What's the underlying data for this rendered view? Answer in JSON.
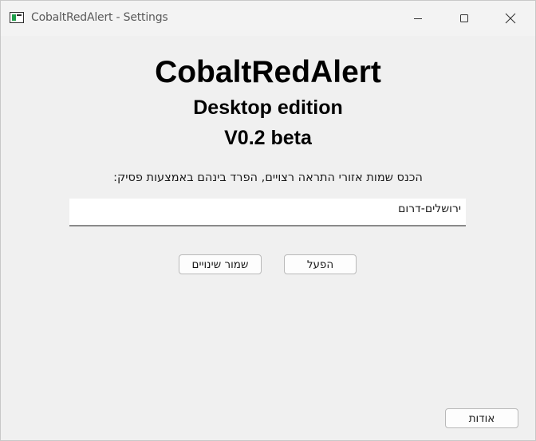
{
  "window": {
    "title": "CobaltRedAlert - Settings",
    "controls": {
      "minimize_icon": "minimize-icon",
      "maximize_icon": "maximize-icon",
      "close_icon": "close-icon"
    }
  },
  "header": {
    "app_name": "CobaltRedAlert",
    "edition": "Desktop edition",
    "version": "V0.2 beta"
  },
  "form": {
    "instruction": "הכנס שמות אזורי התראה רצויים, הפרד בינהם באמצעות פסיק:",
    "areas_value": "ירושלים-דרום"
  },
  "buttons": {
    "save_label": "שמור שינויים",
    "activate_label": "הפעל",
    "about_label": "אודות"
  }
}
